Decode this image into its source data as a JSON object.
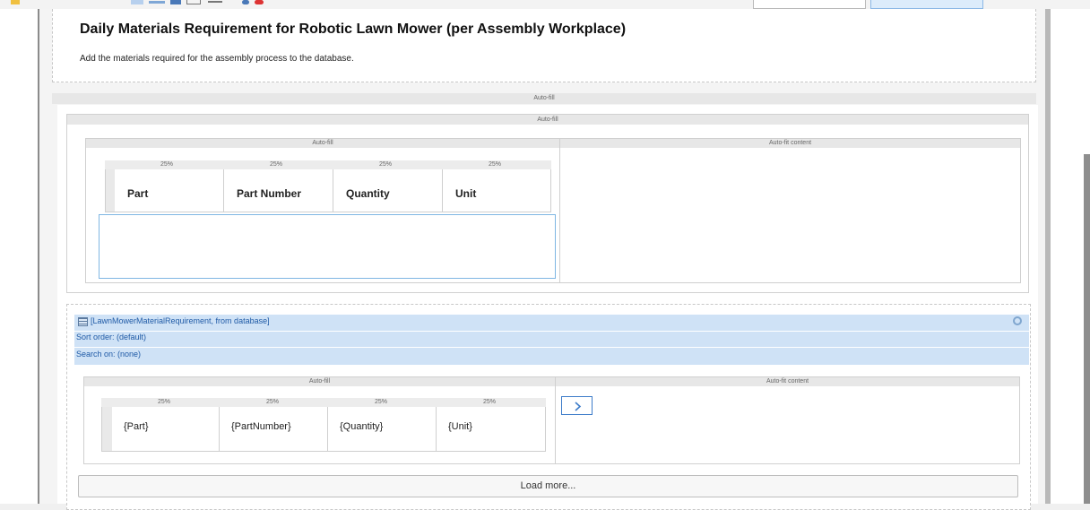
{
  "header": {
    "title": "Daily Materials Requirement for Robotic Lawn Mower (per Assembly Workplace)",
    "subtitle": "Add the materials required for the assembly process to the database."
  },
  "layout_labels": {
    "autofill": "Auto-fill",
    "autofit": "Auto-fit content",
    "pct": "25%"
  },
  "header_table": {
    "columns": [
      "Part",
      "Part Number",
      "Quantity",
      "Unit"
    ]
  },
  "repeater": {
    "source": "[LawnMowerMaterialRequirement, from database]",
    "sort": "Sort order: (default)",
    "search": "Search on: (none)",
    "cells": [
      "{Part}",
      "{PartNumber}",
      "{Quantity}",
      "{Unit}"
    ],
    "next_icon": "chevron-right-icon",
    "load_more": "Load more..."
  }
}
